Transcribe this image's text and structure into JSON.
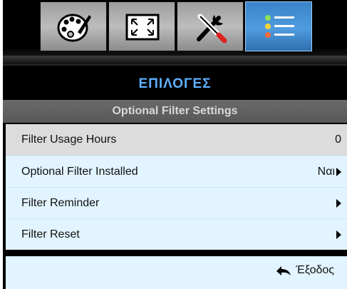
{
  "tabs": [
    {
      "icon": "palette-icon",
      "active": false
    },
    {
      "icon": "resize-screen-icon",
      "active": false
    },
    {
      "icon": "tools-icon",
      "active": false
    },
    {
      "icon": "options-list-icon",
      "active": true
    }
  ],
  "menu": {
    "title": "ΕΠΙΛΟΓΕΣ",
    "subtitle": "Optional Filter Settings"
  },
  "rows": [
    {
      "label": "Filter Usage Hours",
      "value": "0"
    },
    {
      "label": "Optional Filter Installed",
      "value": "Ναι"
    },
    {
      "label": "Filter Reminder",
      "value": ""
    },
    {
      "label": "Filter Reset",
      "value": ""
    }
  ],
  "footer": {
    "exit_label": "Έξοδος"
  },
  "colors": {
    "accent": "#4f9ce0",
    "title": "#5fb0ff",
    "row_bg": "#e2f4ff",
    "selected_bg": "#dcdcdc"
  }
}
